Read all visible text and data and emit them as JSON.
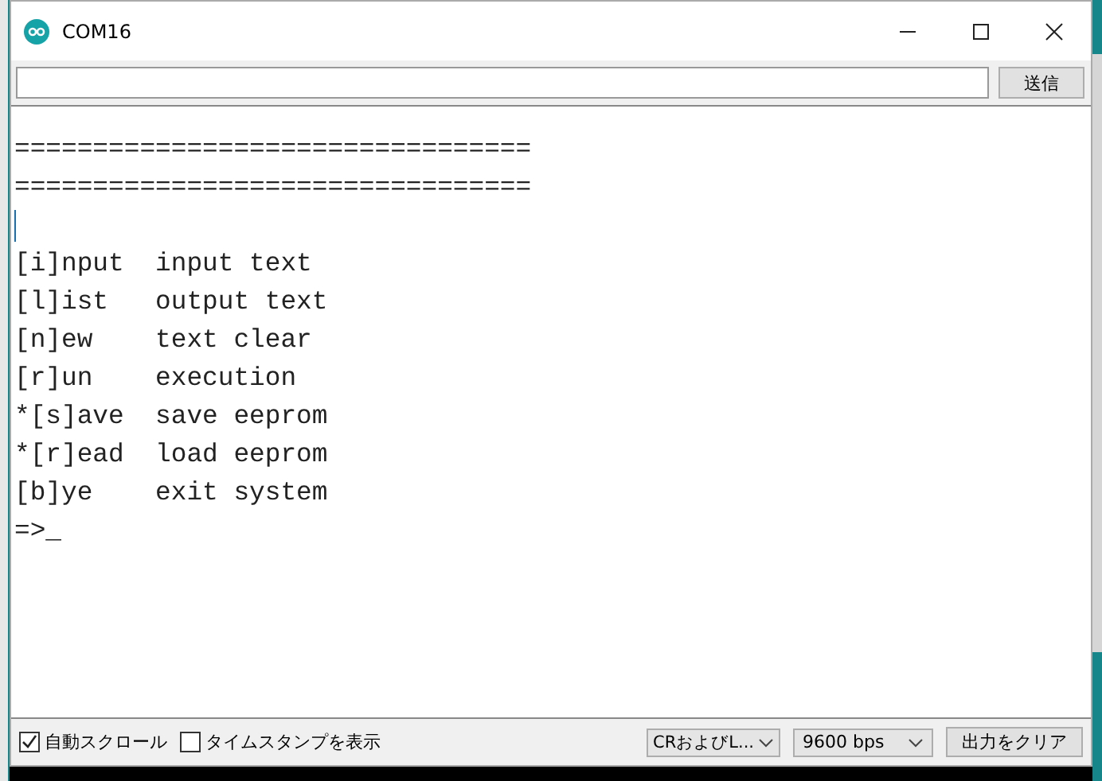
{
  "window": {
    "title": "COM16"
  },
  "send_bar": {
    "button": "送信"
  },
  "output": [
    {
      "kind": "text",
      "text": "================================="
    },
    {
      "kind": "text",
      "text": "================================="
    },
    {
      "kind": "caret"
    },
    {
      "kind": "text",
      "text": "[i]nput  input text"
    },
    {
      "kind": "text",
      "text": "[l]ist   output text"
    },
    {
      "kind": "text",
      "text": "[n]ew    text clear"
    },
    {
      "kind": "text",
      "text": "[r]un    execution"
    },
    {
      "kind": "text",
      "text": "*[s]ave  save eeprom"
    },
    {
      "kind": "text",
      "text": "*[r]ead  load eeprom"
    },
    {
      "kind": "text",
      "text": "[b]ye    exit system"
    },
    {
      "kind": "text",
      "text": "=>_"
    }
  ],
  "status_bar": {
    "checkboxes": [
      {
        "label": "自動スクロール",
        "checked": true
      },
      {
        "label": "タイムスタンプを表示",
        "checked": false
      }
    ],
    "line_ending": "CRおよびL...",
    "baud_rate": "9600 bps",
    "clear_button": "出力をクリア"
  }
}
